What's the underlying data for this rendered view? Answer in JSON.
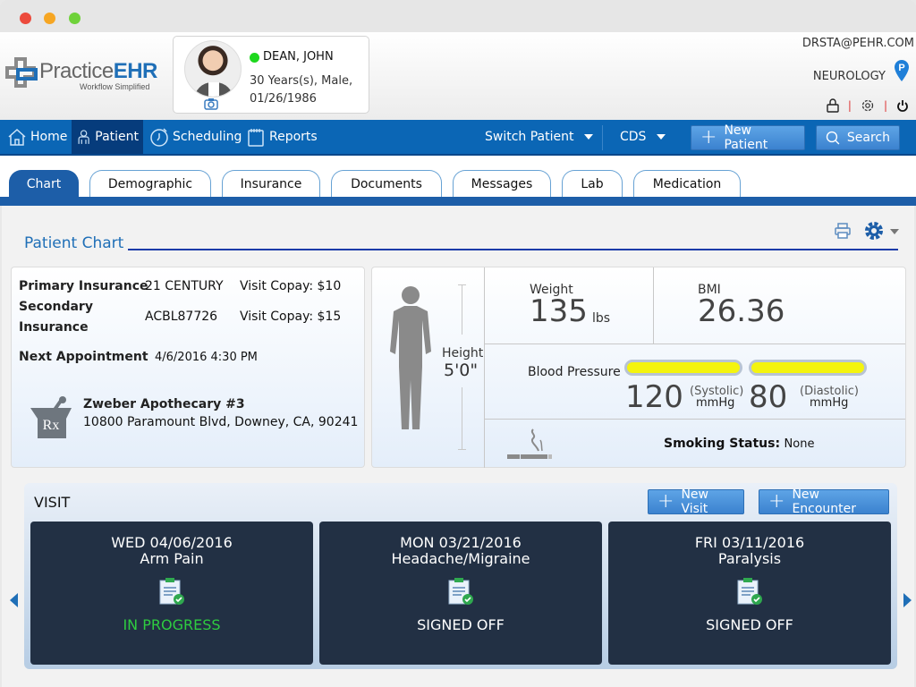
{
  "window": {
    "controls": [
      "close",
      "minimize",
      "maximize"
    ]
  },
  "brand": {
    "name_light": "Practice",
    "name_bold": "EHR",
    "tagline": "Workflow Simplified"
  },
  "patient": {
    "name": "DEAN, JOHN",
    "status_color": "#1ed81e",
    "age_sex": "30 Years(s), Male,",
    "dob": "01/26/1986"
  },
  "user": {
    "email": "DRSTA@PEHR.COM",
    "department": "NEUROLOGY",
    "location_badge": "P"
  },
  "nav": {
    "items": [
      {
        "label": "Home",
        "icon": "home-icon"
      },
      {
        "label": "Patient",
        "icon": "patient-icon",
        "active": true
      },
      {
        "label": "Scheduling",
        "icon": "clock-icon"
      },
      {
        "label": "Reports",
        "icon": "calendar-icon"
      }
    ],
    "switch_patient": "Switch Patient",
    "cds": "CDS",
    "new_patient": "New Patient",
    "search": "Search"
  },
  "tabs": [
    "Chart",
    "Demographic",
    "Insurance",
    "Documents",
    "Messages",
    "Lab",
    "Medication"
  ],
  "page": {
    "title": "Patient Chart"
  },
  "insurance": {
    "primary_label": "Primary Insurance",
    "primary_value": "21 CENTURY",
    "primary_copay": "Visit Copay: $10",
    "secondary_label_1": "Secondary",
    "secondary_label_2": "Insurance",
    "secondary_value": "ACBL87726",
    "secondary_copay": "Visit Copay: $15",
    "next_appt_label": "Next Appointment",
    "next_appt_value": "4/6/2016 4:30 PM"
  },
  "pharmacy": {
    "name": "Zweber Apothecary #3",
    "address": "10800 Paramount Blvd, Downey, CA, 90241",
    "icon_text": "Rx"
  },
  "vitals": {
    "height_label": "Height",
    "height_value": "5'0\"",
    "weight_label": "Weight",
    "weight_value": "135",
    "weight_unit": "lbs",
    "bmi_label": "BMI",
    "bmi_value": "26.36",
    "bp_label": "Blood Pressure",
    "systolic_value": "120",
    "systolic_label": "(Systolic)",
    "diastolic_value": "80",
    "diastolic_label": "(Diastolic)",
    "bp_unit": "mmHg",
    "bp_indicator_color": "#f4f40e",
    "smoking_label": "Smoking Status:",
    "smoking_value": "None"
  },
  "visit": {
    "title": "VISIT",
    "new_visit": "New Visit",
    "new_encounter": "New Encounter",
    "cards": [
      {
        "date": "WED 04/06/2016",
        "reason": "Arm Pain",
        "status": "IN PROGRESS",
        "status_color": "#2ecc40"
      },
      {
        "date": "MON 03/21/2016",
        "reason": "Headache/Migraine",
        "status": "SIGNED OFF",
        "status_color": "#ffffff"
      },
      {
        "date": "FRI 03/11/2016",
        "reason": "Paralysis",
        "status": "SIGNED OFF",
        "status_color": "#ffffff"
      }
    ]
  }
}
